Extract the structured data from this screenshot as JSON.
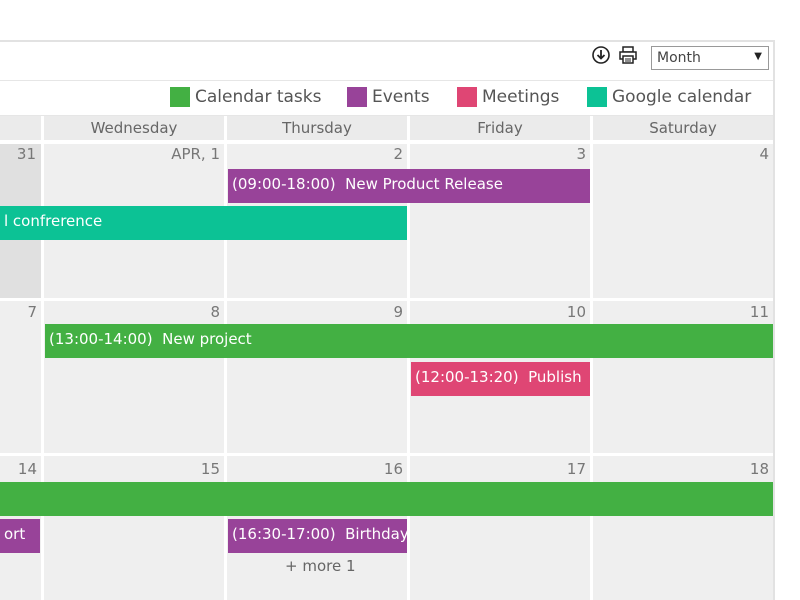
{
  "toolbar": {
    "view_selected": "Month"
  },
  "legend": [
    {
      "label": "Calendar tasks",
      "color": "#43b043"
    },
    {
      "label": "Events",
      "color": "#984399"
    },
    {
      "label": "Meetings",
      "color": "#df4674"
    },
    {
      "label": "Google calendar",
      "color": "#0cc295"
    }
  ],
  "weekdays": [
    "Wednesday",
    "Thursday",
    "Friday",
    "Saturday"
  ],
  "weeks": [
    {
      "days": [
        "31",
        "APR, 1",
        "2",
        "3",
        "4"
      ]
    },
    {
      "days": [
        "7",
        "8",
        "9",
        "10",
        "11"
      ]
    },
    {
      "days": [
        "14",
        "15",
        "16",
        "17",
        "18"
      ]
    }
  ],
  "events": [
    {
      "time": "(09:00-18:00)",
      "title": "New Product Release",
      "category": "Events",
      "color": "#984399"
    },
    {
      "time": "",
      "title": "l confrerence",
      "category": "Google calendar",
      "color": "#0cc295"
    },
    {
      "time": "(13:00-14:00)",
      "title": "New project",
      "category": "Calendar tasks",
      "color": "#43b043"
    },
    {
      "time": "(12:00-13:20)",
      "title": "Publish",
      "category": "Meetings",
      "color": "#df4674"
    },
    {
      "time": "",
      "title": "",
      "category": "Calendar tasks",
      "color": "#43b043"
    },
    {
      "time": "",
      "title": "ort",
      "category": "Events",
      "color": "#984399"
    },
    {
      "time": "(16:30-17:00)",
      "title": "Birthday",
      "category": "Events",
      "color": "#984399"
    }
  ],
  "more": {
    "label": "+ more 1"
  }
}
